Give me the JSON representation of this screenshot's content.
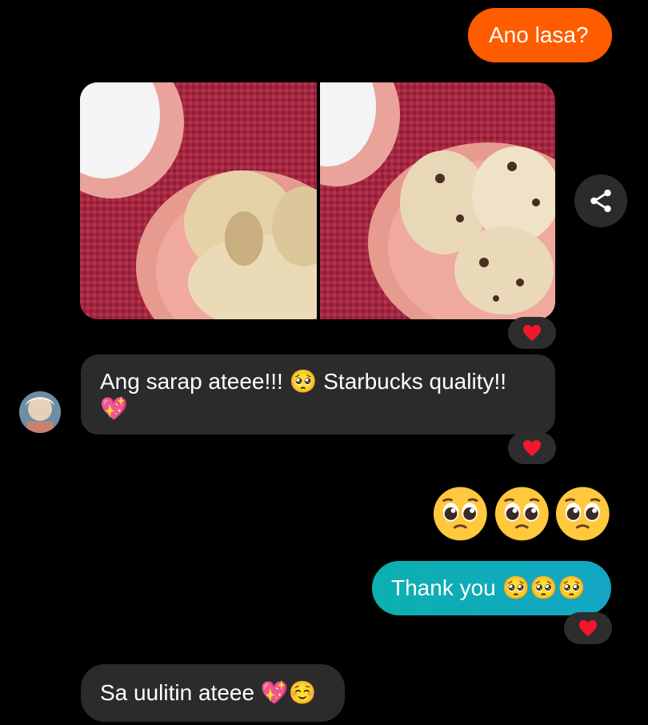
{
  "messages": {
    "m1": {
      "text": "Ano lasa?",
      "color": "#ff5c00",
      "side": "right"
    },
    "m2": {
      "text": "Ang sarap ateee!!! 🥺 Starbucks quality!! 💖",
      "side": "left",
      "reaction": "heart"
    },
    "m3": {
      "emoji": [
        "pleading-face",
        "pleading-face",
        "pleading-face"
      ],
      "side": "right"
    },
    "m4": {
      "text": "Thank you 🥺🥺🥺",
      "color": "#0cb0b0",
      "side": "right",
      "reaction": "heart"
    },
    "m5": {
      "text": "Sa uulitin ateee 💖☺️",
      "side": "left"
    }
  },
  "photos": [
    {
      "name": "oatmeal-cookies-photo",
      "reaction": "heart"
    },
    {
      "name": "chocolate-chip-cookies-photo"
    }
  ],
  "icons": {
    "share": "share-icon",
    "reaction": "heart-icon",
    "avatar": "contact-avatar"
  }
}
